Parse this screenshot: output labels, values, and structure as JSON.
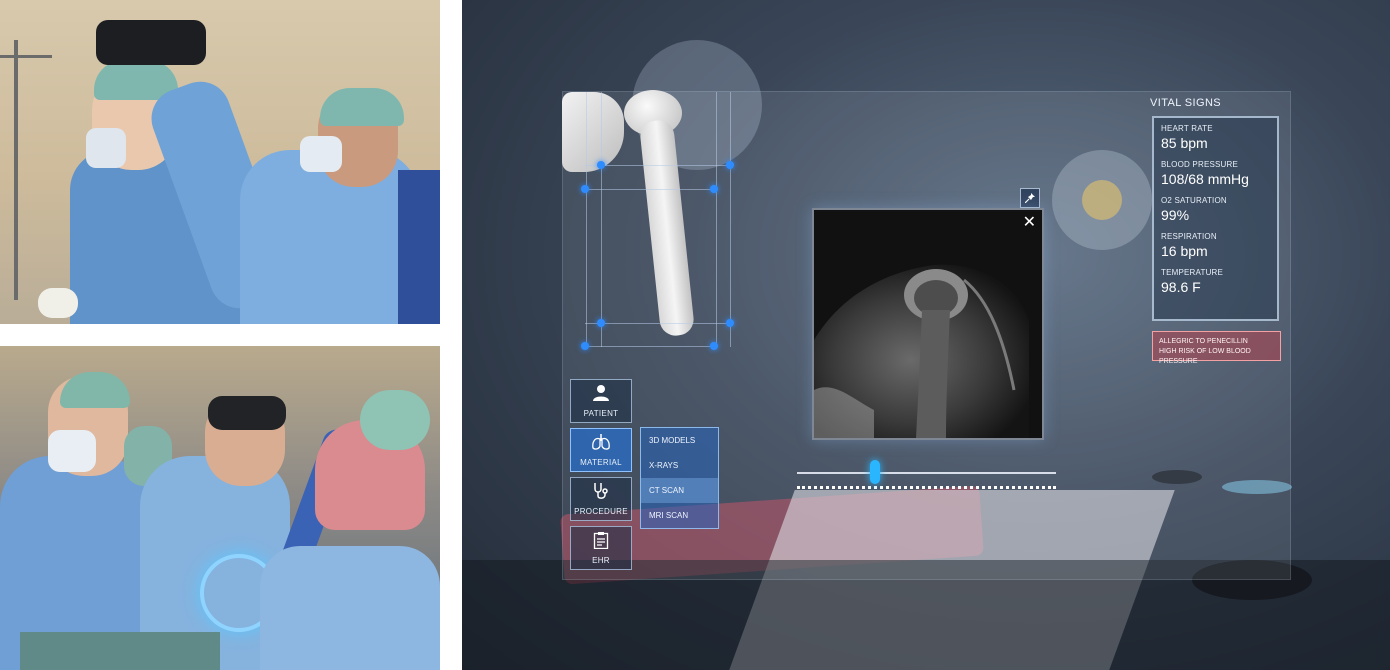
{
  "menu": {
    "items": [
      {
        "label": "PATIENT",
        "icon": "person-icon"
      },
      {
        "label": "MATERIAL",
        "icon": "lungs-icon"
      },
      {
        "label": "PROCEDURE",
        "icon": "stethoscope-icon"
      },
      {
        "label": "EHR",
        "icon": "clipboard-icon"
      }
    ],
    "active": "MATERIAL"
  },
  "submenu": {
    "items": [
      "3D MODELS",
      "X-RAYS",
      "CT SCAN",
      "MRI SCAN"
    ],
    "active": "CT SCAN"
  },
  "viewer": {
    "close_glyph": "✕",
    "pin_icon": "pin-icon"
  },
  "slider": {
    "value": 0.3
  },
  "vitals": {
    "title": "VITAL SIGNS",
    "items": [
      {
        "label": "HEART RATE",
        "value": "85 bpm"
      },
      {
        "label": "BLOOD PRESSURE",
        "value": "108/68 mmHg"
      },
      {
        "label": "O2 SATURATION",
        "value": "99%"
      },
      {
        "label": "RESPIRATION",
        "value": "16 bpm"
      },
      {
        "label": "TEMPERATURE",
        "value": "98.6 F"
      }
    ],
    "alerts": [
      "ALLEGRIC TO PENECILLIN",
      "HIGH RISK OF LOW BLOOD PRESSURE"
    ]
  },
  "colors": {
    "accent": "#2f8cff",
    "slider_handle": "#2ab6ff",
    "alert_bg": "#b44650"
  }
}
